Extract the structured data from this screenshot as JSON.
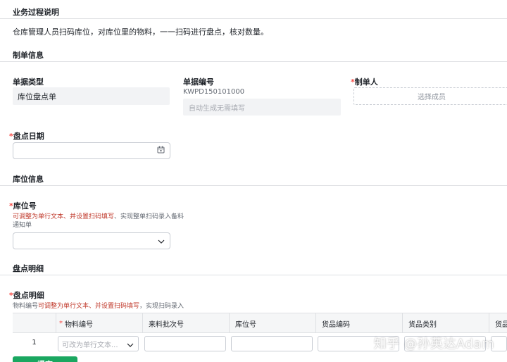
{
  "sections": {
    "process": "业务过程说明",
    "bill_info": "制单信息",
    "location_info": "库位信息",
    "detail": "盘点明细"
  },
  "process_description": "仓库管理人员扫码库位，对库位里的物料，一一扫码进行盘点，核对数量。",
  "bill_type": {
    "label": "单据类型",
    "value": "库位盘点单"
  },
  "bill_no": {
    "label": "单据编号",
    "value": "KWPD150101000",
    "placeholder": "自动生成无需填写"
  },
  "creator": {
    "required_mark": "*",
    "label": "制单人",
    "placeholder": "选择成员"
  },
  "count_date": {
    "required_mark": "*",
    "label": "盘点日期",
    "icon": "calendar-icon"
  },
  "location_no": {
    "required_mark": "*",
    "label": "库位号",
    "hint_red": "可调整为单行文本、并设置扫码填写",
    "hint_rest": "、实现整单扫码录入备料通知单",
    "icon": "chevron-down-icon"
  },
  "detail_field": {
    "required_mark": "*",
    "label": "盘点明细",
    "hint_pre": "物料编号",
    "hint_red": "可调整为单行文本、并设置扫码填写",
    "hint_post": "，实现扫码录入"
  },
  "table": {
    "columns": [
      {
        "label": "",
        "required": false
      },
      {
        "label": "物料编号",
        "required": true
      },
      {
        "label": "来料批次号",
        "required": false
      },
      {
        "label": "库位号",
        "required": false
      },
      {
        "label": "货品编码",
        "required": false
      },
      {
        "label": "货品类别",
        "required": false
      },
      {
        "label": "货品",
        "required": false
      }
    ],
    "rows": [
      {
        "index": "1",
        "material_placeholder": "可改为单行文本..."
      }
    ]
  },
  "submit_label": "提交",
  "watermark": "知乎 @孙英达Adam",
  "colors": {
    "accent_green": "#1aa760",
    "required_red": "#f54a45",
    "hint_red": "#c0392b"
  }
}
